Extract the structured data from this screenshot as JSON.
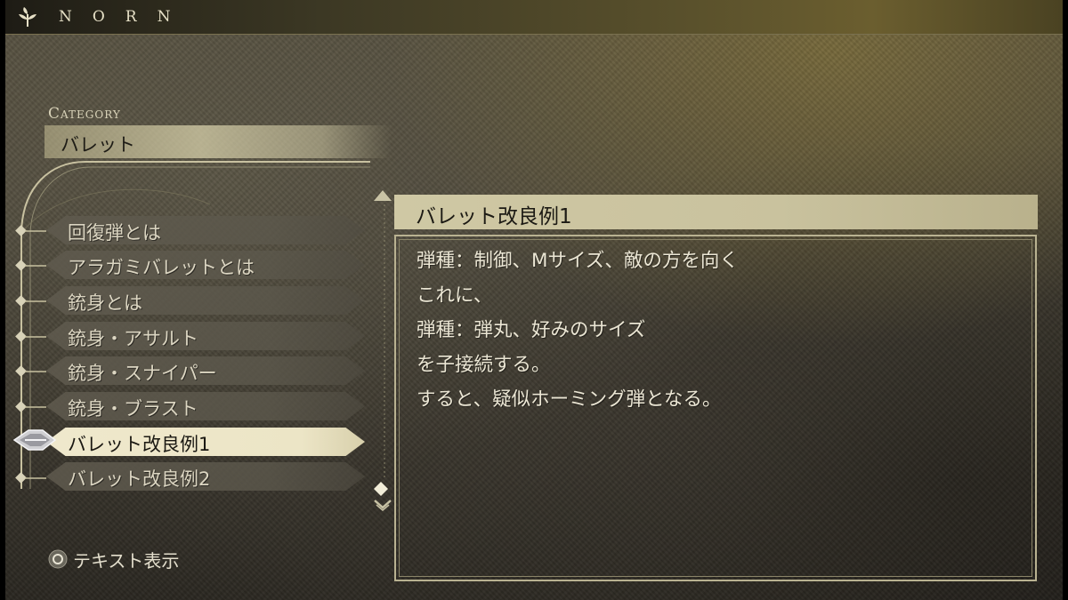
{
  "header": {
    "app_title": "NORN"
  },
  "category": {
    "heading": "Category",
    "value": "バレット"
  },
  "list": {
    "items": [
      {
        "label": "回復弾とは",
        "selected": false
      },
      {
        "label": "アラガミバレットとは",
        "selected": false
      },
      {
        "label": "銃身とは",
        "selected": false
      },
      {
        "label": "銃身・アサルト",
        "selected": false
      },
      {
        "label": "銃身・スナイパー",
        "selected": false
      },
      {
        "label": "銃身・ブラスト",
        "selected": false
      },
      {
        "label": "バレット改良例1",
        "selected": true
      },
      {
        "label": "バレット改良例2",
        "selected": false
      }
    ]
  },
  "document": {
    "title": "バレット改良例1",
    "lines": [
      "弾種：制御、Mサイズ、敵の方を向く",
      "これに、",
      "弾種：弾丸、好みのサイズ",
      "を子接続する。",
      "すると、疑似ホーミング弾となる。"
    ]
  },
  "footer": {
    "hint_icon": "circle-button-icon",
    "hint_label": "テキスト表示"
  },
  "colors": {
    "selected_fill": "#efe8cc",
    "title_bar": "#cfc8a4",
    "text": "#ebe6d4"
  }
}
